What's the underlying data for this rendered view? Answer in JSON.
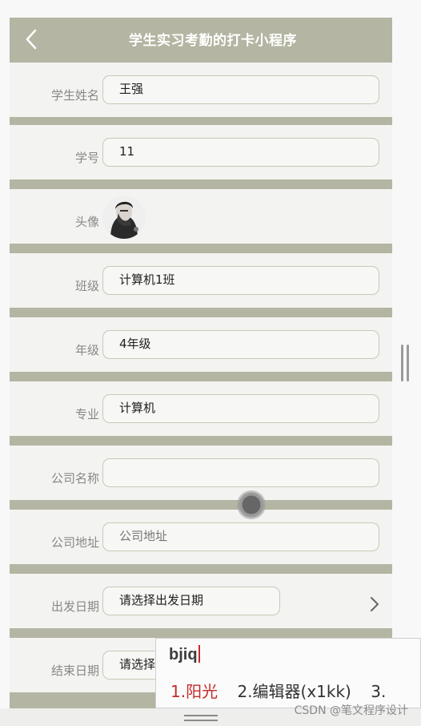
{
  "header": {
    "title": "学生实习考勤的打卡小程序",
    "back_icon": "chevron-left-icon"
  },
  "form": [
    {
      "key": "name",
      "label": "学生姓名",
      "value": "王强",
      "kind": "text"
    },
    {
      "key": "student_no",
      "label": "学号",
      "value": "11",
      "kind": "text"
    },
    {
      "key": "avatar",
      "label": "头像",
      "kind": "avatar"
    },
    {
      "key": "class",
      "label": "班级",
      "value": "计算机1班",
      "kind": "text"
    },
    {
      "key": "grade",
      "label": "年级",
      "value": "4年级",
      "kind": "text"
    },
    {
      "key": "major",
      "label": "专业",
      "value": "计算机",
      "kind": "text"
    },
    {
      "key": "company_name",
      "label": "公司名称",
      "value": "",
      "kind": "text"
    },
    {
      "key": "company_address",
      "label": "公司地址",
      "placeholder": "公司地址",
      "kind": "text"
    },
    {
      "key": "start_date",
      "label": "出发日期",
      "value": "请选择出发日期",
      "kind": "date"
    },
    {
      "key": "end_date",
      "label": "结束日期",
      "value": "请选择",
      "kind": "date"
    }
  ],
  "ime": {
    "input": "bjiq",
    "candidates": [
      "1.阳光",
      "2.编辑器(x1kk)",
      "3."
    ]
  },
  "watermark": "CSDN @笔文程序设计",
  "colors": {
    "accent": "#b4b5a2",
    "ime_highlight": "#c42b2b"
  }
}
